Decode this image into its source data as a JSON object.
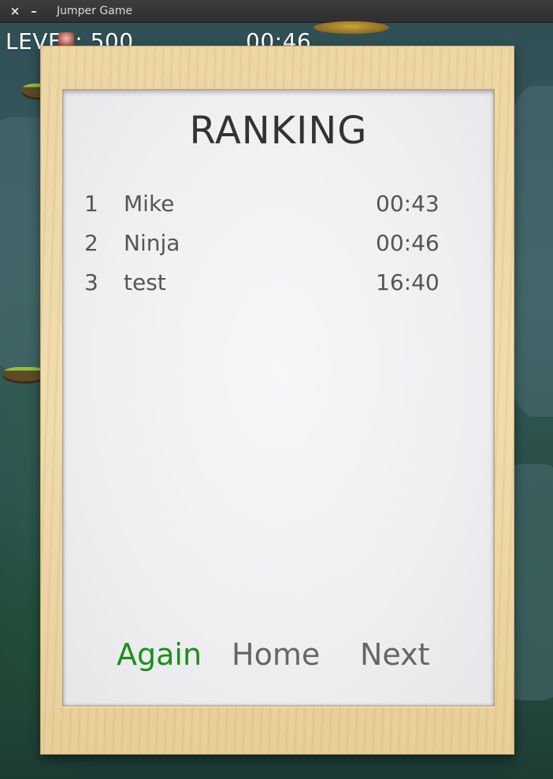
{
  "window": {
    "title": "Jumper Game",
    "close_symbol": "×",
    "minimize_symbol": "–"
  },
  "hud": {
    "level_text": "LEVEL: 500",
    "time": "00:46"
  },
  "ranking": {
    "title": "RANKING",
    "entries": [
      {
        "rank": "1",
        "name": "Mike",
        "time": "00:43"
      },
      {
        "rank": "2",
        "name": "Ninja",
        "time": "00:46"
      },
      {
        "rank": "3",
        "name": "test",
        "time": "16:40"
      }
    ]
  },
  "actions": {
    "again": "Again",
    "home": "Home",
    "next": "Next"
  },
  "colors": {
    "again": "#1a8f1a",
    "inactive_action": "#666666",
    "board_wood": "#ecd6a4"
  }
}
